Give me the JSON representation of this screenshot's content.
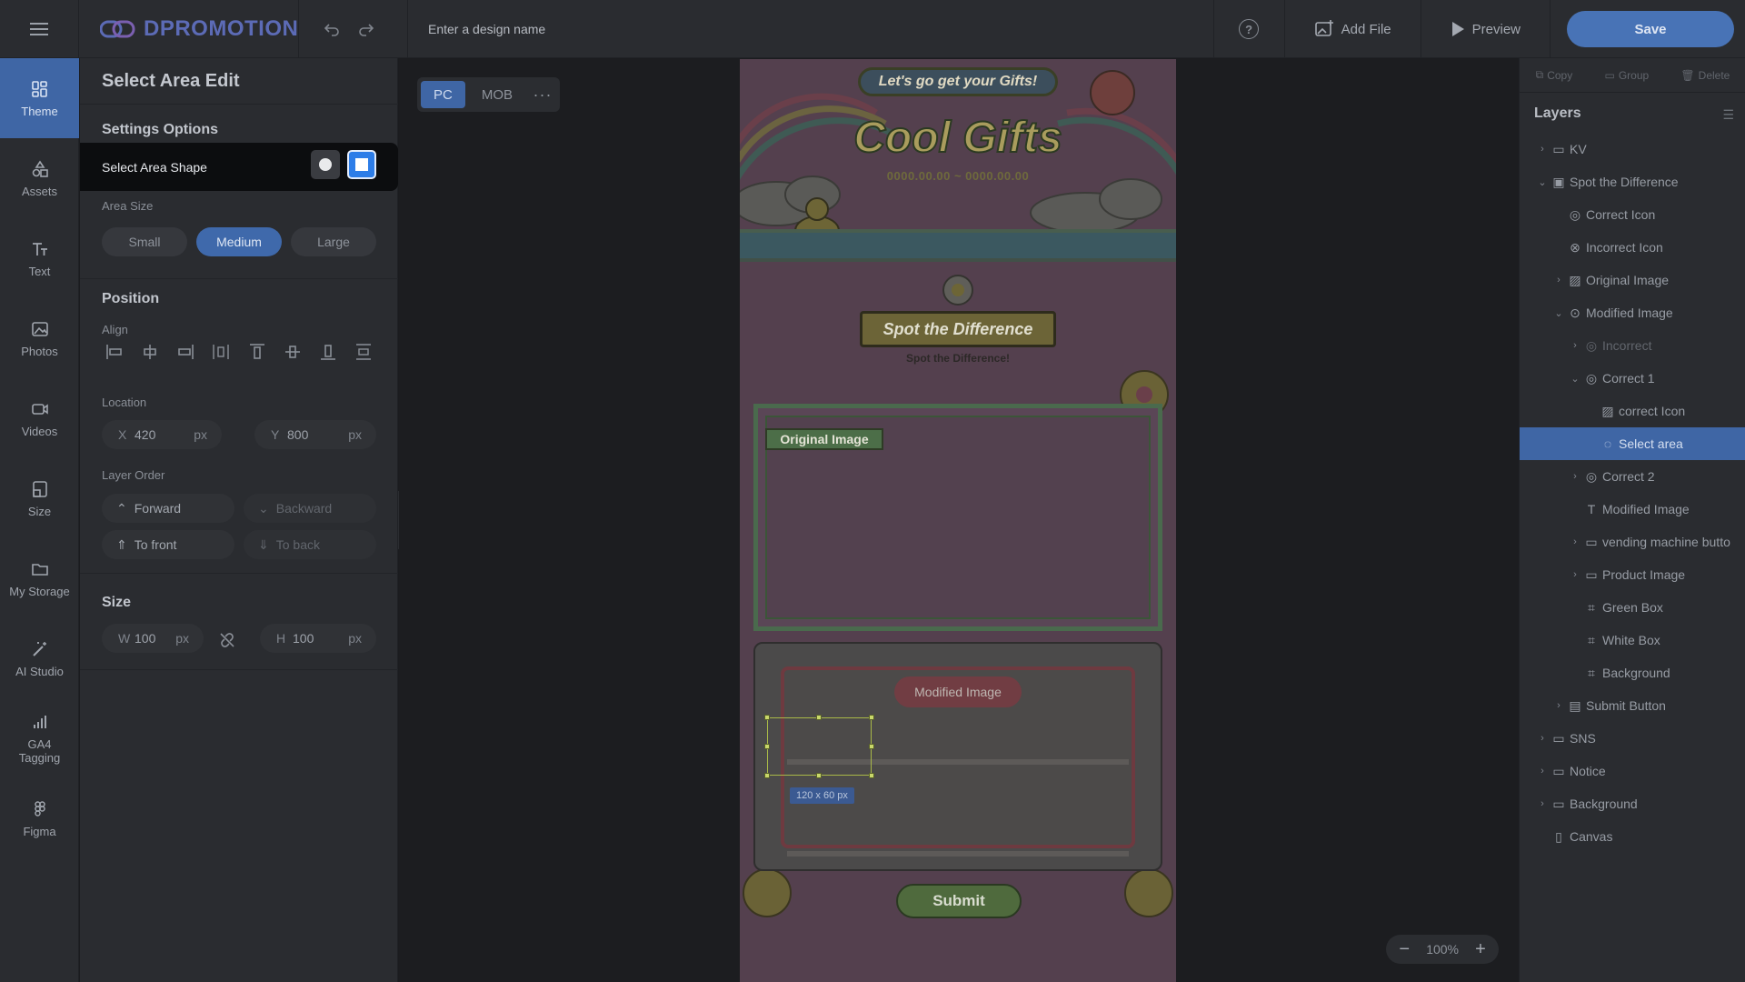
{
  "app": {
    "brand": "DPROMOTION",
    "design_name_placeholder": "Enter a design name",
    "actions": {
      "add_file": "Add File",
      "preview": "Preview",
      "save": "Save"
    }
  },
  "nav": {
    "items": [
      {
        "id": "theme",
        "label": "Theme",
        "icon": "theme-icon",
        "active": true
      },
      {
        "id": "assets",
        "label": "Assets",
        "icon": "assets-icon"
      },
      {
        "id": "text",
        "label": "Text",
        "icon": "text-icon"
      },
      {
        "id": "photos",
        "label": "Photos",
        "icon": "photo-icon"
      },
      {
        "id": "videos",
        "label": "Videos",
        "icon": "video-icon"
      },
      {
        "id": "size",
        "label": "Size",
        "icon": "size-icon"
      },
      {
        "id": "storage",
        "label": "My Storage",
        "icon": "folder-icon"
      },
      {
        "id": "ai",
        "label": "AI Studio",
        "icon": "magic-wand-icon"
      },
      {
        "id": "ga4",
        "label": "GA4\nTagging",
        "icon": "bar-chart-icon"
      },
      {
        "id": "figma",
        "label": "Figma",
        "icon": "figma-icon"
      }
    ]
  },
  "panel": {
    "title": "Select Area Edit",
    "settings_options": "Settings Options",
    "select_area_shape": "Select Area Shape",
    "shape_selected": "square",
    "area_size_label": "Area Size",
    "area_sizes": [
      "Small",
      "Medium",
      "Large"
    ],
    "area_size_selected": "Medium",
    "position_title": "Position",
    "align_label": "Align",
    "location_label": "Location",
    "location": {
      "x_label": "X",
      "x": "420",
      "y_label": "Y",
      "y": "800",
      "unit": "px"
    },
    "layer_order_label": "Layer Order",
    "layer_order": {
      "forward": "Forward",
      "backward": "Backward",
      "to_front": "To front",
      "to_back": "To back"
    },
    "size_title": "Size",
    "size": {
      "w_label": "W",
      "w": "100",
      "h_label": "H",
      "h": "100",
      "unit": "px"
    }
  },
  "canvas": {
    "device_tabs": [
      "PC",
      "MOB"
    ],
    "device_active": "PC",
    "zoom": "100%",
    "design": {
      "tagline": "Let's go get your Gifts!",
      "headline": "Cool Gifts",
      "date_range": "0000.00.00 ~ 0000.00.00",
      "banner": "Spot the Difference",
      "banner_sub": "Spot the Difference!",
      "original_label": "Original Image",
      "modified_label": "Modified Image",
      "submit": "Submit",
      "selection_size": "120 x 60 px"
    }
  },
  "layers": {
    "toolbar": {
      "copy": "Copy",
      "group": "Group",
      "delete": "Delete"
    },
    "title": "Layers",
    "items": [
      {
        "label": "KV",
        "depth": 0,
        "chevron": "right",
        "icon": "folder-icon"
      },
      {
        "label": "Spot the Difference",
        "depth": 0,
        "chevron": "down",
        "icon": "frame-icon"
      },
      {
        "label": "Correct Icon",
        "depth": 1,
        "chevron": "",
        "icon": "target-icon"
      },
      {
        "label": "Incorrect Icon",
        "depth": 1,
        "chevron": "",
        "icon": "x-circle-icon"
      },
      {
        "label": "Original Image",
        "depth": 1,
        "chevron": "right",
        "icon": "image-icon"
      },
      {
        "label": "Modified Image",
        "depth": 1,
        "chevron": "down",
        "icon": "search-icon"
      },
      {
        "label": "Incorrect",
        "depth": 2,
        "chevron": "right",
        "icon": "target-icon",
        "dim": true
      },
      {
        "label": "Correct 1",
        "depth": 2,
        "chevron": "down",
        "icon": "target-icon"
      },
      {
        "label": "correct Icon",
        "depth": 3,
        "chevron": "",
        "icon": "image-icon"
      },
      {
        "label": "Select area",
        "depth": 3,
        "chevron": "",
        "icon": "dashed-circle-icon",
        "selected": true
      },
      {
        "label": "Correct 2",
        "depth": 2,
        "chevron": "right",
        "icon": "target-icon"
      },
      {
        "label": "Modified Image",
        "depth": 2,
        "chevron": "",
        "icon": "text-icon"
      },
      {
        "label": "vending machine butto",
        "depth": 2,
        "chevron": "right",
        "icon": "folder-icon"
      },
      {
        "label": "Product Image",
        "depth": 2,
        "chevron": "right",
        "icon": "folder-icon"
      },
      {
        "label": "Green Box",
        "depth": 2,
        "chevron": "",
        "icon": "shape-icon"
      },
      {
        "label": "White Box",
        "depth": 2,
        "chevron": "",
        "icon": "shape-icon"
      },
      {
        "label": "Background",
        "depth": 2,
        "chevron": "",
        "icon": "shape-icon"
      },
      {
        "label": "Submit Button",
        "depth": 1,
        "chevron": "right",
        "icon": "button-icon"
      },
      {
        "label": "SNS",
        "depth": 0,
        "chevron": "right",
        "icon": "folder-icon"
      },
      {
        "label": "Notice",
        "depth": 0,
        "chevron": "right",
        "icon": "folder-icon"
      },
      {
        "label": "Background",
        "depth": 0,
        "chevron": "right",
        "icon": "folder-icon"
      },
      {
        "label": "Canvas",
        "depth": 0,
        "chevron": "",
        "icon": "page-icon"
      }
    ]
  }
}
